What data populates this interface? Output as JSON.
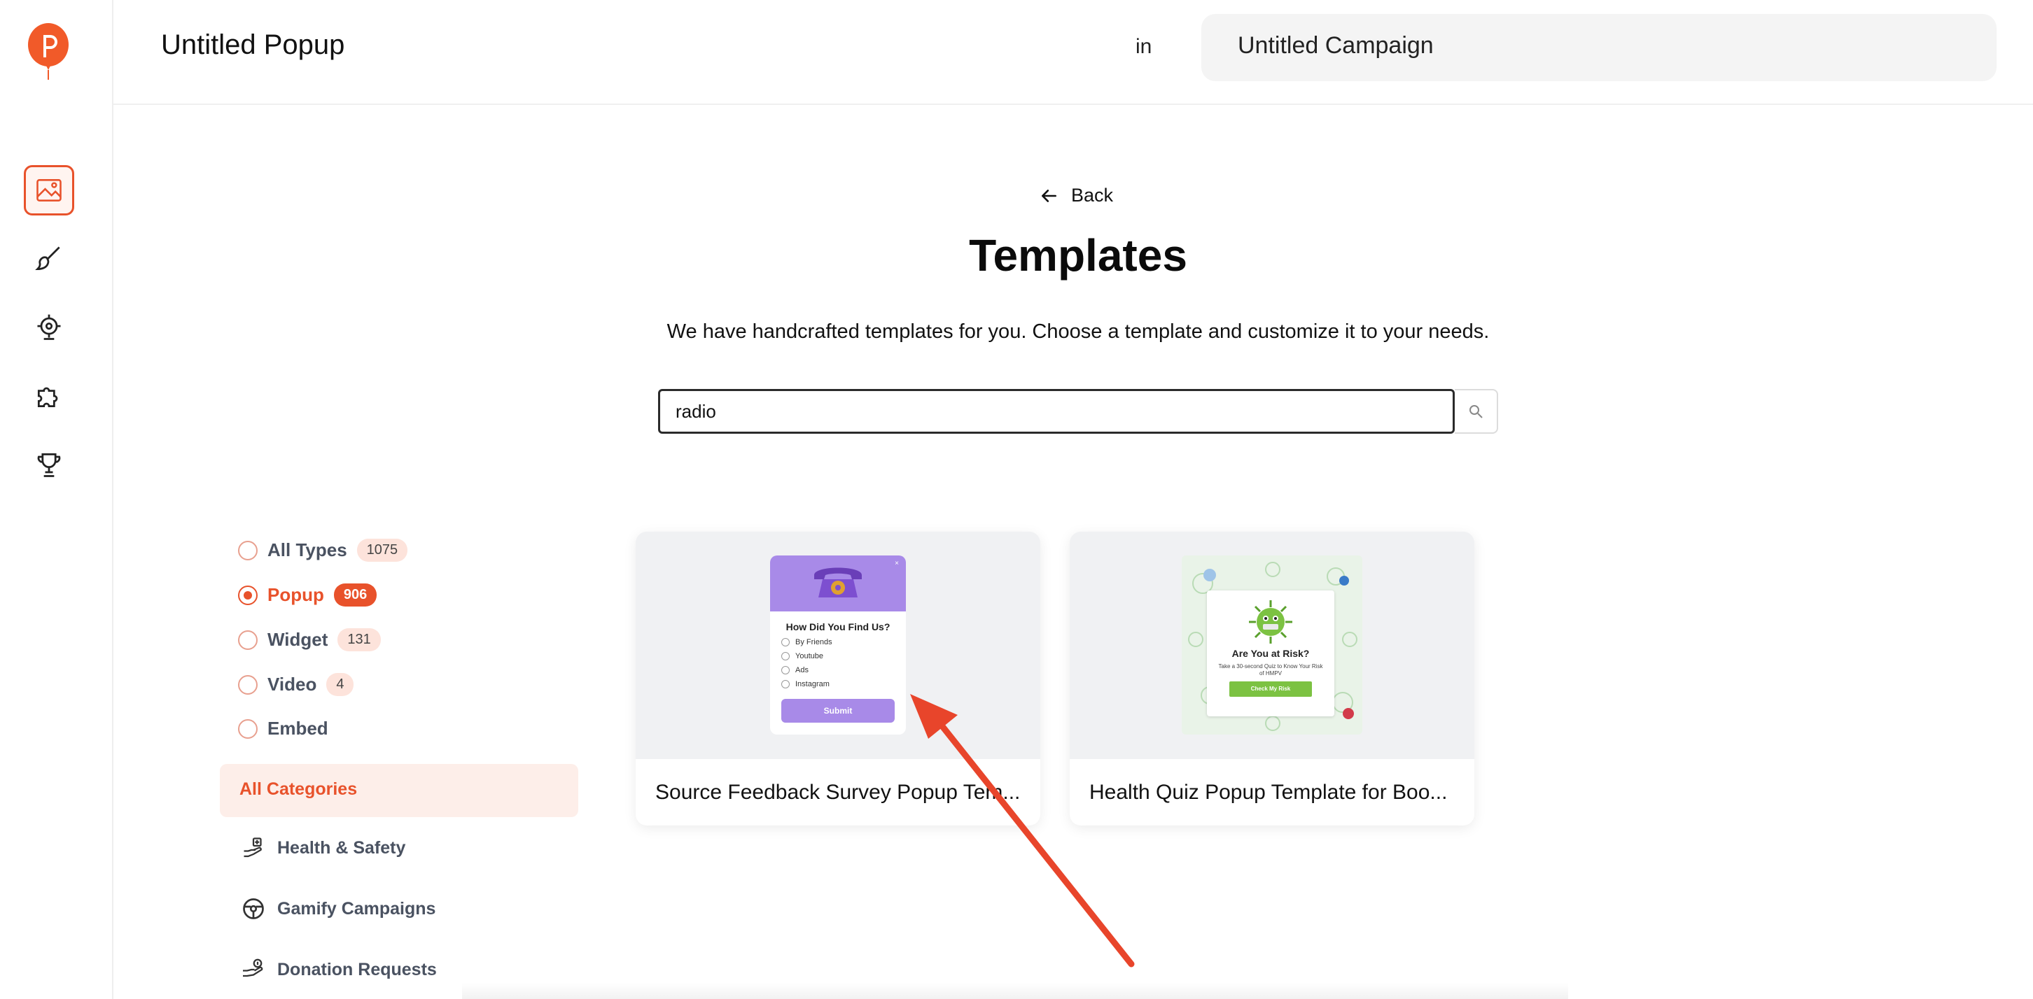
{
  "header": {
    "popup_title": "Untitled Popup",
    "in_label": "in",
    "campaign_name": "Untitled Campaign"
  },
  "rail": {
    "icons": [
      "templates-icon",
      "brush-icon",
      "target-icon",
      "puzzle-icon",
      "trophy-icon"
    ],
    "active": "templates-icon"
  },
  "back_label": "Back",
  "page": {
    "title": "Templates",
    "subtitle": "We have handcrafted templates for you. Choose a template and customize it to your needs."
  },
  "search": {
    "value": "radio",
    "placeholder": ""
  },
  "types": [
    {
      "label": "All Types",
      "count": "1075",
      "selected": false
    },
    {
      "label": "Popup",
      "count": "906",
      "selected": true
    },
    {
      "label": "Widget",
      "count": "131",
      "selected": false
    },
    {
      "label": "Video",
      "count": "4",
      "selected": false
    },
    {
      "label": "Embed",
      "count": "",
      "selected": false
    }
  ],
  "categories": {
    "header": "All Categories",
    "items": [
      {
        "label": "Health & Safety",
        "icon": "health-icon"
      },
      {
        "label": "Gamify Campaigns",
        "icon": "steering-wheel-icon"
      },
      {
        "label": "Donation Requests",
        "icon": "donation-icon"
      }
    ]
  },
  "templates": [
    {
      "title": "Source Feedback Survey Popup Tem...",
      "preview": {
        "question": "How Did You Find Us?",
        "options": [
          "By Friends",
          "Youtube",
          "Ads",
          "Instagram"
        ],
        "button": "Submit",
        "close": "×"
      }
    },
    {
      "title": "Health Quiz Popup Template for Boo...",
      "preview": {
        "heading": "Are You at Risk?",
        "text": "Take a 30-second Quiz to Know Your Risk of HMPV",
        "button": "Check My Risk"
      }
    }
  ],
  "colors": {
    "accent": "#e8522b",
    "accent_light": "#fdeee9",
    "survey_purple": "#a88ae8",
    "quiz_green": "#7cc242",
    "annotation_arrow": "#e8452b"
  }
}
